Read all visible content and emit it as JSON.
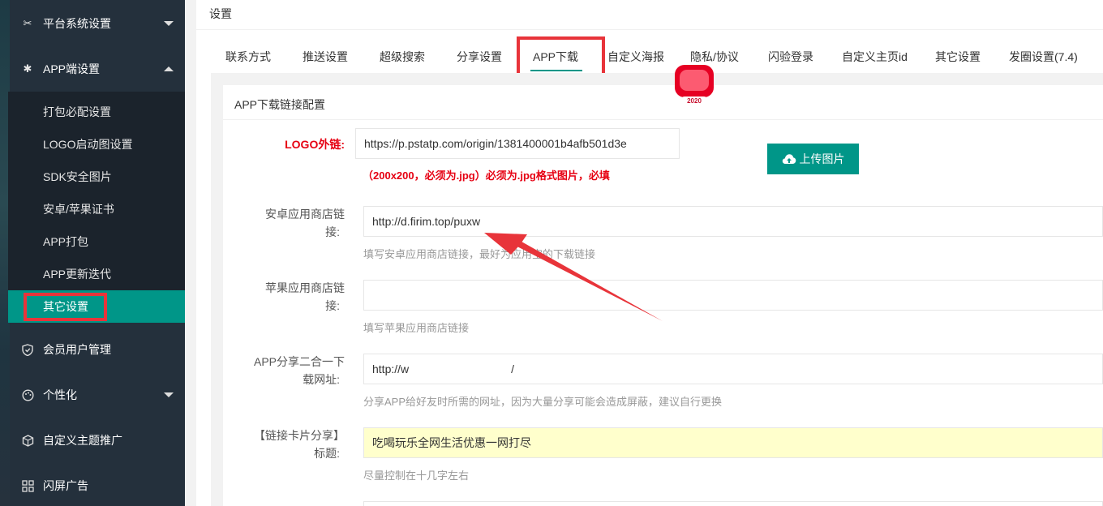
{
  "sidebar": {
    "groups": [
      {
        "label": "平台系统设置",
        "icon": "tools-icon",
        "state": "collapsed"
      },
      {
        "label": "APP端设置",
        "icon": "gear-icon",
        "state": "expanded"
      },
      {
        "label": "会员用户管理",
        "icon": "shield-icon"
      },
      {
        "label": "个性化",
        "icon": "palette-icon",
        "state": "collapsed"
      },
      {
        "label": "自定义主题推广",
        "icon": "box-icon"
      },
      {
        "label": "闪屏广告",
        "icon": "grid-icon"
      }
    ],
    "app_items": [
      {
        "label": "打包必配设置"
      },
      {
        "label": "LOGO启动图设置"
      },
      {
        "label": "SDK安全图片"
      },
      {
        "label": "安卓/苹果证书"
      },
      {
        "label": "APP打包"
      },
      {
        "label": "APP更新迭代"
      },
      {
        "label": "其它设置",
        "active": true
      }
    ]
  },
  "main": {
    "title": "设置",
    "tabs": [
      {
        "label": "联系方式"
      },
      {
        "label": "推送设置"
      },
      {
        "label": "超级搜索"
      },
      {
        "label": "分享设置"
      },
      {
        "label": "APP下载",
        "active": true
      },
      {
        "label": "自定义海报"
      },
      {
        "label": "隐私/协议"
      },
      {
        "label": "闪验登录"
      },
      {
        "label": "自定义主页id"
      },
      {
        "label": "其它设置"
      },
      {
        "label": "发圈设置(7.4)"
      }
    ],
    "section_title": "APP下载链接配置",
    "form": {
      "logo": {
        "label": "LOGO外链:",
        "value": "https://p.pstatp.com/origin/1381400001b4afb501d3e",
        "hint": "（200x200，必须为.jpg）必须为.jpg格式图片，必填",
        "thumb_text": "2020",
        "upload_label": "上传图片"
      },
      "android": {
        "label_line1": "安卓应用商店链",
        "label_line2": "接:",
        "value": "http://d.firim.top/puxw",
        "hint": "填写安卓应用商店链接，最好为应用宝的下载链接"
      },
      "ios": {
        "label_line1": "苹果应用商店链",
        "label_line2": "接:",
        "value": "",
        "hint": "填写苹果应用商店链接"
      },
      "share_download": {
        "label_line1": "APP分享二合一下",
        "label_line2": "载网址:",
        "value_prefix": "http://w",
        "value_suffix": "/",
        "hint": "分享APP给好友时所需的网址，因为大量分享可能会造成屏蔽，建议自行更换"
      },
      "card_share": {
        "label_line1": "【链接卡片分享】",
        "label_line2": "标题:",
        "value": "吃喝玩乐全网生活优惠一网打尽",
        "hint": "尽量控制在十几字左右"
      }
    }
  },
  "colors": {
    "accent": "#009688",
    "sidebar_bg": "#24303c",
    "annotation_red": "#e8343a",
    "required_red": "#e60012"
  }
}
